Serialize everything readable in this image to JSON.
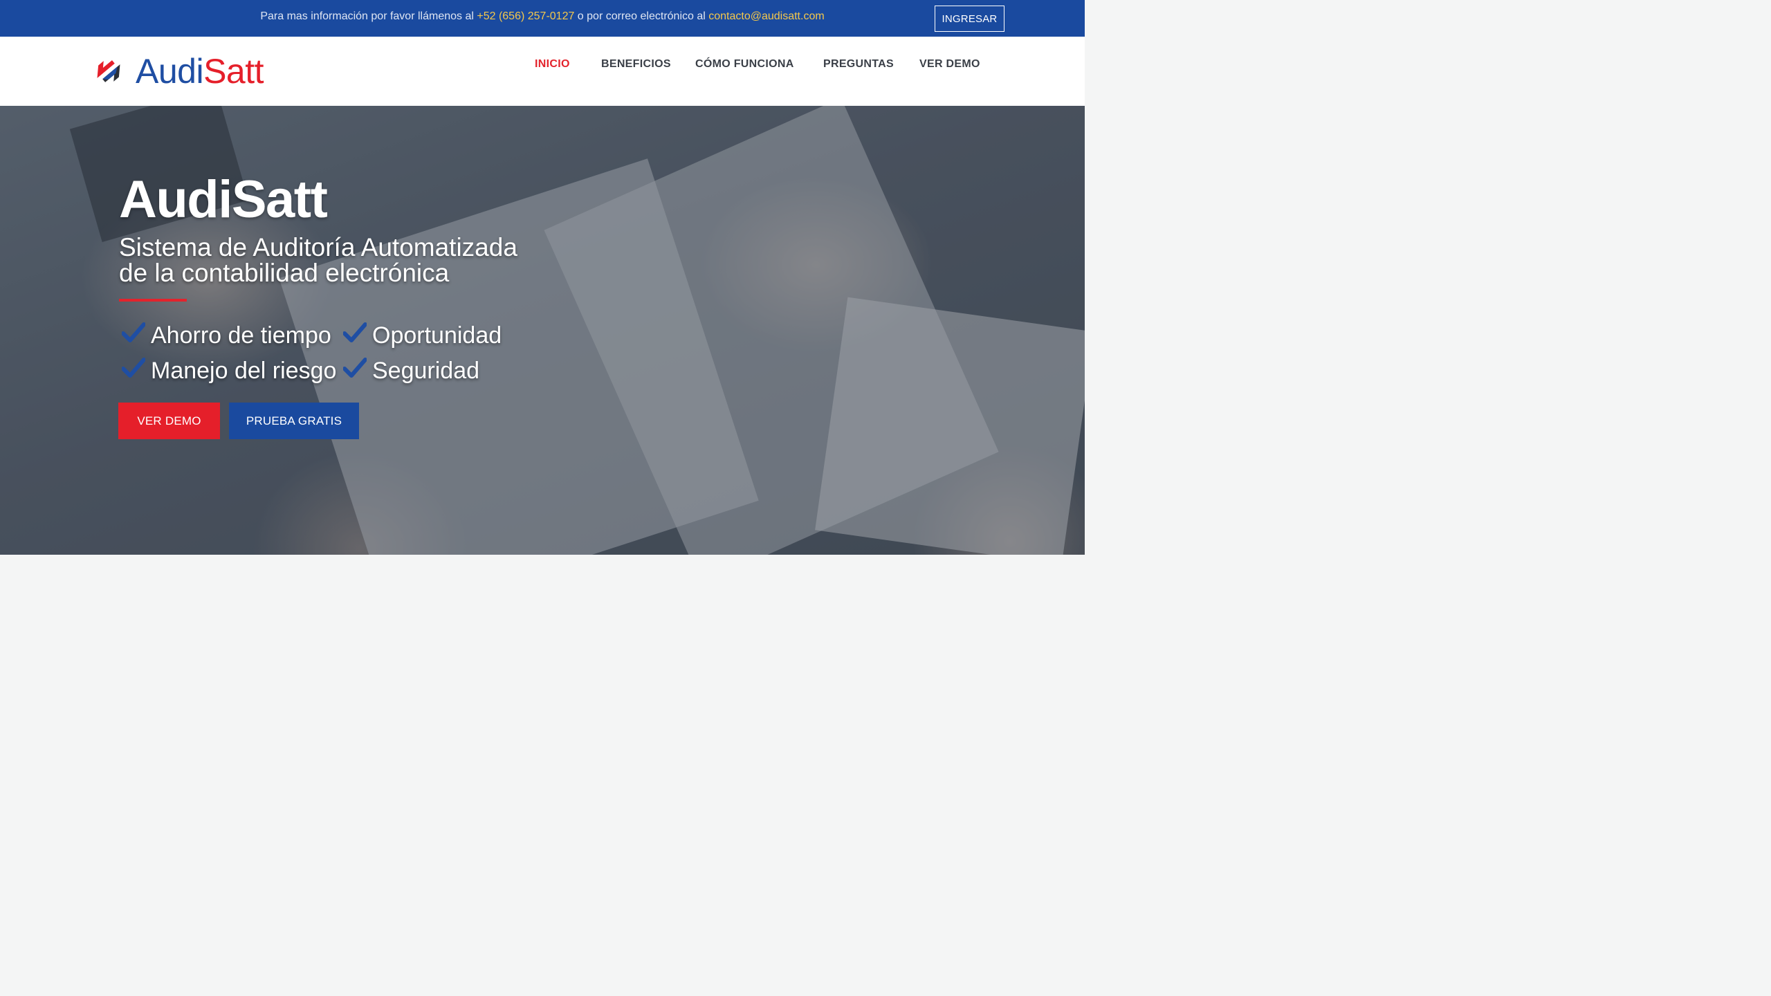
{
  "topbar": {
    "text_prefix": "Para mas información por favor llámenos al ",
    "phone": "+52 (656) 257-0127",
    "text_middle": " o por correo electrónico al ",
    "email": "contacto@audisatt.com",
    "login_label": "INGRESAR"
  },
  "header": {
    "logo_part1": "Audi",
    "logo_part2": "Satt",
    "nav": [
      {
        "label": "INICIO",
        "active": true
      },
      {
        "label": "BENEFICIOS",
        "active": false
      },
      {
        "label": "CÓMO FUNCIONA",
        "active": false
      },
      {
        "label": "PREGUNTAS",
        "active": false
      },
      {
        "label": "VER DEMO",
        "active": false
      }
    ]
  },
  "hero": {
    "title": "AudiSatt",
    "subtitle_line1": "Sistema de Auditoría Automatizada",
    "subtitle_line2": "de la contabilidad electrónica",
    "features": [
      "Ahorro de tiempo",
      "Oportunidad",
      "Manejo del riesgo",
      "Seguridad"
    ],
    "demo_button": "VER DEMO",
    "trial_button": "PRUEBA GRATIS"
  },
  "colors": {
    "brand_blue": "#1a4a9f",
    "brand_red": "#e51f2a",
    "accent_yellow": "#f5c84b",
    "check_blue": "#1f4ea3"
  }
}
